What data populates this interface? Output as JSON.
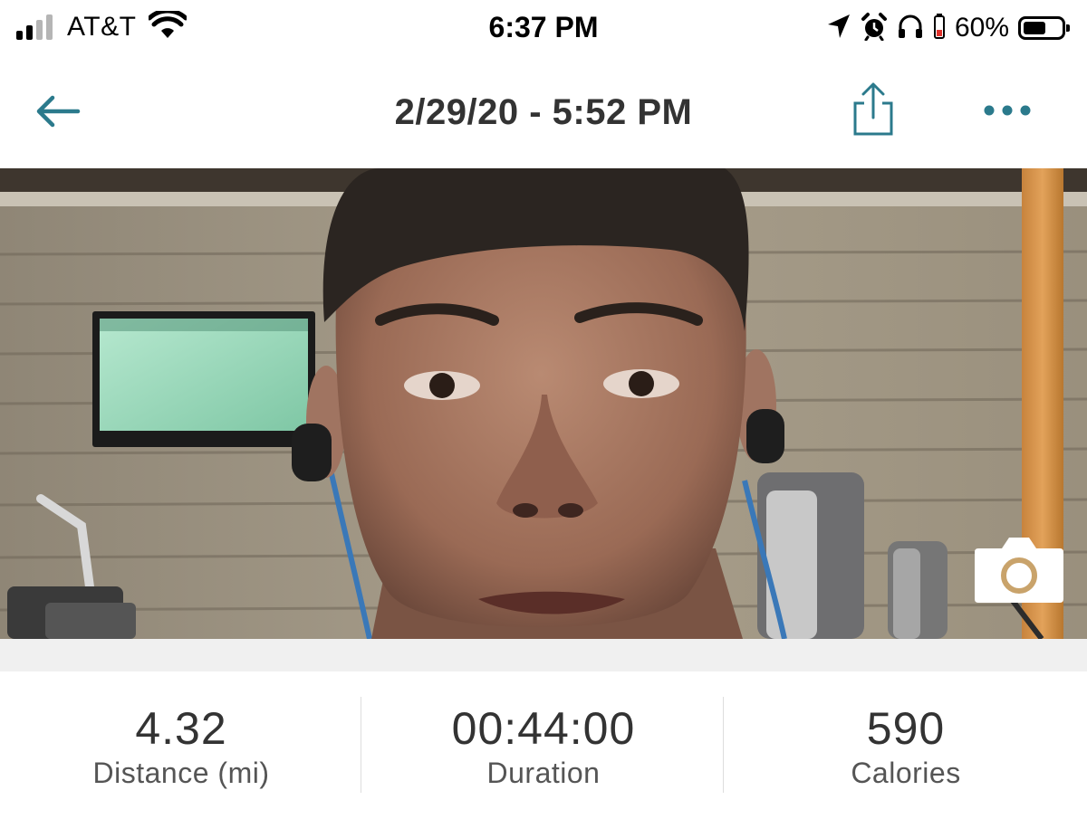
{
  "status_bar": {
    "carrier": "AT&T",
    "time": "6:37 PM",
    "battery_percent": "60%",
    "signal_bars_active": 2,
    "signal_bars_total": 4,
    "battery_level": 0.6,
    "icons": [
      "signal-icon",
      "wifi-icon",
      "location-arrow-icon",
      "alarm-icon",
      "headphones-icon",
      "low-battery-device-icon",
      "battery-icon"
    ]
  },
  "nav": {
    "title": "2/29/20 - 5:52 PM",
    "back_icon": "arrow-left-icon",
    "share_icon": "share-icon",
    "more_icon": "more-dots-icon",
    "accent_color": "#2b7a8c"
  },
  "photo": {
    "camera_icon": "camera-icon"
  },
  "stats": [
    {
      "value": "4.32",
      "label": "Distance (mi)"
    },
    {
      "value": "00:44:00",
      "label": "Duration"
    },
    {
      "value": "590",
      "label": "Calories"
    }
  ]
}
